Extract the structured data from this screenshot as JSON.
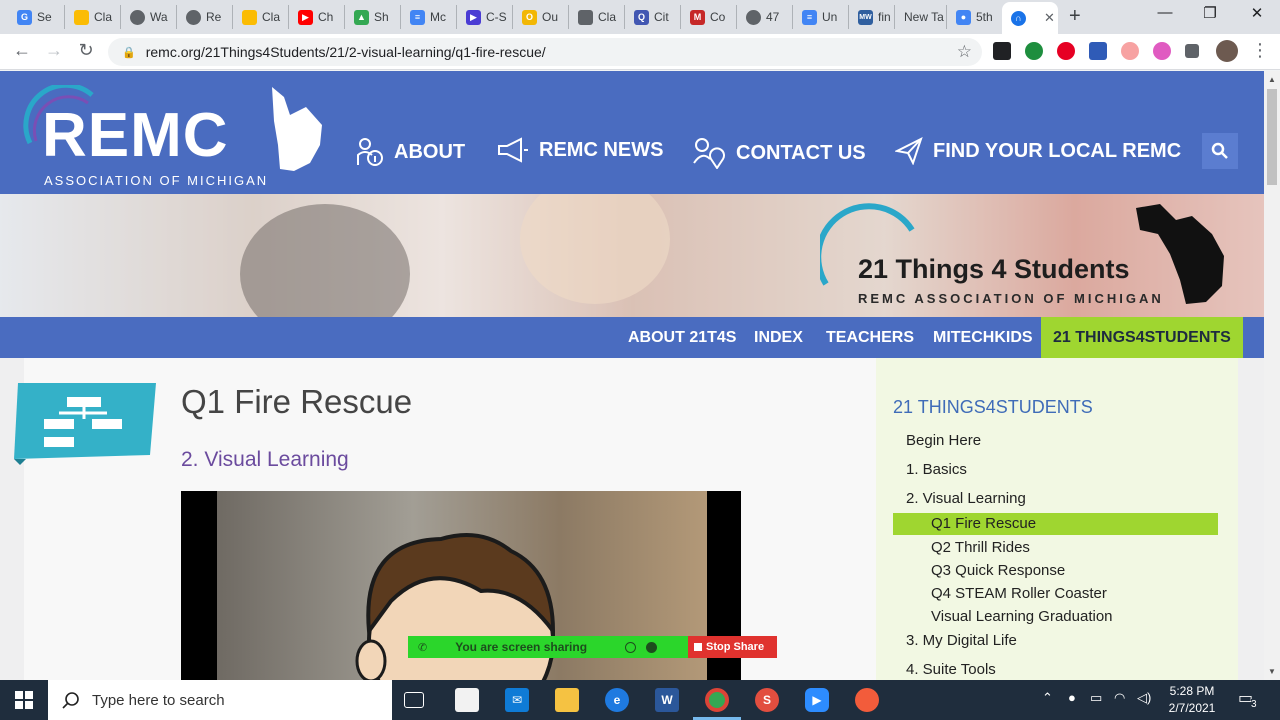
{
  "browser": {
    "tabs": [
      {
        "label": "Se",
        "icon": "google-icon",
        "color": "#4285f4"
      },
      {
        "label": "Cla",
        "icon": "classroom-icon",
        "color": "#fbbc04"
      },
      {
        "label": "Wa",
        "icon": "globe-icon",
        "color": "#5f6368"
      },
      {
        "label": "Re",
        "icon": "globe-icon",
        "color": "#5f6368"
      },
      {
        "label": "Cla",
        "icon": "classroom-icon",
        "color": "#fbbc04"
      },
      {
        "label": "Ch",
        "icon": "youtube-icon",
        "color": "#ff0000"
      },
      {
        "label": "Sh",
        "icon": "drive-icon",
        "color": "#34a853"
      },
      {
        "label": "Mc",
        "icon": "docs-icon",
        "color": "#4285f4"
      },
      {
        "label": "C-S",
        "icon": "play-icon",
        "color": "#4a3cd4"
      },
      {
        "label": "Ou",
        "icon": "note-icon",
        "color": "#f2b705"
      },
      {
        "label": "Cla",
        "icon": "portrait-icon",
        "color": "#5f6368"
      },
      {
        "label": "Cit",
        "icon": "quizlet-icon",
        "color": "#4257b2"
      },
      {
        "label": "Co",
        "icon": "m-icon",
        "color": "#c62828"
      },
      {
        "label": "47",
        "icon": "globe-icon",
        "color": "#5f6368"
      },
      {
        "label": "Un",
        "icon": "docs-icon",
        "color": "#4285f4"
      },
      {
        "label": "fin",
        "icon": "mw-icon",
        "color": "#305f9f"
      },
      {
        "label": "New Ta",
        "icon": "",
        "color": ""
      },
      {
        "label": "5th",
        "icon": "person-icon",
        "color": "#4285f4"
      },
      {
        "label": "",
        "icon": "headset-icon",
        "color": "#1a73e8"
      }
    ],
    "new_tab": "+",
    "window_controls": {
      "minimize": "—",
      "maximize": "❐",
      "close": "✕"
    },
    "url": "remc.org/21Things4Students/21/2-visual-learning/q1-fire-rescue/"
  },
  "site": {
    "logo_text": "REMC",
    "logo_sub": "ASSOCIATION OF MICHIGAN",
    "nav": [
      {
        "label": "ABOUT",
        "icon": "person-info-icon"
      },
      {
        "label": "REMC NEWS",
        "icon": "megaphone-icon"
      },
      {
        "label": "CONTACT US",
        "icon": "person-pin-icon"
      },
      {
        "label": "FIND YOUR LOCAL REMC",
        "icon": "paper-plane-icon"
      }
    ],
    "banner_title": "21 Things 4 Students",
    "banner_sub": "REMC ASSOCIATION OF MICHIGAN",
    "subnav": [
      {
        "label": "ABOUT 21T4S",
        "active": false
      },
      {
        "label": "INDEX",
        "active": false
      },
      {
        "label": "TEACHERS",
        "active": false
      },
      {
        "label": "MITECHKIDS",
        "active": false
      },
      {
        "label": "21 THINGS4STUDENTS",
        "active": true
      }
    ],
    "page_title": "Q1 Fire Rescue",
    "page_subtitle": "2. Visual Learning",
    "sidebar": {
      "heading": "21 THINGS4STUDENTS",
      "items": [
        {
          "label": "Begin Here",
          "level": 0,
          "active": false
        },
        {
          "label": "1. Basics",
          "level": 0,
          "active": false
        },
        {
          "label": "2. Visual Learning",
          "level": 0,
          "active": false
        },
        {
          "label": "Q1 Fire Rescue",
          "level": 1,
          "active": true
        },
        {
          "label": "Q2 Thrill Rides",
          "level": 1,
          "active": false
        },
        {
          "label": "Q3 Quick Response",
          "level": 1,
          "active": false
        },
        {
          "label": "Q4 STEAM Roller Coaster",
          "level": 1,
          "active": false
        },
        {
          "label": "Visual Learning Graduation",
          "level": 1,
          "active": false
        },
        {
          "label": "3. My Digital Life",
          "level": 0,
          "active": false
        },
        {
          "label": "4. Suite Tools",
          "level": 0,
          "active": false
        }
      ]
    }
  },
  "zoom_share": {
    "status": "You are screen sharing",
    "stop": "Stop Share"
  },
  "taskbar": {
    "search_placeholder": "Type here to search",
    "time": "5:28 PM",
    "date": "2/7/2021",
    "notification_count": "3",
    "apps": [
      "task-view-icon",
      "store-icon",
      "mail-icon",
      "file-explorer-icon",
      "edge-icon",
      "word-icon",
      "chrome-icon",
      "app-icon",
      "zoom-icon",
      "screencast-icon"
    ]
  }
}
